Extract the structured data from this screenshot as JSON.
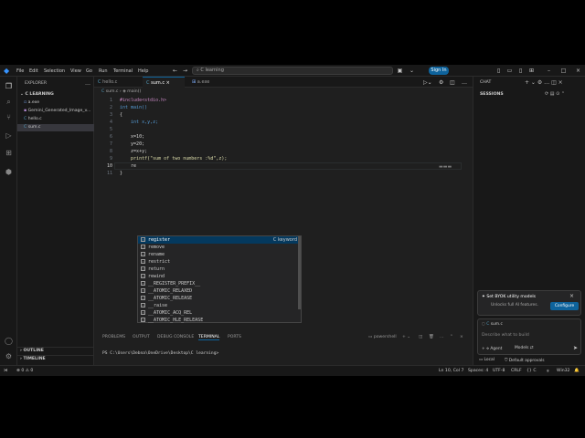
{
  "menu": [
    "File",
    "Edit",
    "Selection",
    "View",
    "Go",
    "Run",
    "Terminal",
    "Help"
  ],
  "search": {
    "text": "C learning"
  },
  "signin": "Sign In",
  "explorer": {
    "title": "EXPLORER",
    "folder": "C LEARNING",
    "files": [
      {
        "icon": "▫",
        "name": "a.exe"
      },
      {
        "icon": "▪",
        "name": "Gemini_Generated_Image_v..."
      },
      {
        "icon": "C",
        "name": "hello.c"
      },
      {
        "icon": "C",
        "name": "sum.c"
      }
    ],
    "outline": "OUTLINE",
    "timeline": "TIMELINE"
  },
  "tabs": [
    {
      "icon": "C",
      "name": "hello.c"
    },
    {
      "icon": "C",
      "name": "sum.c"
    },
    {
      "icon": "⊞",
      "name": "a.exe"
    }
  ],
  "breadcrumb": {
    "file": "sum.c",
    "sym": "main()"
  },
  "code": {
    "line_numbers": [
      "1",
      "2",
      "3",
      "4",
      "5",
      "6",
      "7",
      "8",
      "9",
      "10",
      "11"
    ],
    "lines": [
      "#include<stdio.h>",
      "int main()",
      "{",
      "    int x,y,z;",
      "",
      "    x=10;",
      "    y=20;",
      "    z=x+y;",
      "    printf(\"sum of two numbers :%d\",z);",
      "    re",
      "}"
    ]
  },
  "suggestions": {
    "detail": "C keyword",
    "items": [
      {
        "icon": "▭",
        "label": "register"
      },
      {
        "icon": "▭",
        "label": "remove"
      },
      {
        "icon": "▭",
        "label": "rename"
      },
      {
        "icon": "▭",
        "label": "restrict"
      },
      {
        "icon": "▭",
        "label": "return"
      },
      {
        "icon": "▭",
        "label": "rewind"
      },
      {
        "icon": "▭",
        "label": "__REGISTER_PREFIX__"
      },
      {
        "icon": "▭",
        "label": "__ATOMIC_RELAXED"
      },
      {
        "icon": "▭",
        "label": "__ATOMIC_RELEASE"
      },
      {
        "icon": "▭",
        "label": "__raise"
      },
      {
        "icon": "▭",
        "label": "__ATOMIC_ACQ_REL"
      },
      {
        "icon": "▭",
        "label": "__ATOMIC_HLE_RELEASE"
      }
    ]
  },
  "panel": {
    "tabs": [
      "PROBLEMS",
      "OUTPUT",
      "DEBUG CONSOLE",
      "TERMINAL",
      "PORTS"
    ],
    "shell": "powershell",
    "terminal_line": "PS C:\\Users\\Debna\\OneDrive\\Desktop\\C learning>"
  },
  "chat": {
    "title": "CHAT",
    "sessions": "SESSIONS",
    "promo_title": "Set BYOK utility models",
    "promo_sub": "Unlocks full AI features.",
    "configure": "Configure",
    "context": "sum.c",
    "placeholder": "Describe what to build",
    "agent": "Agent",
    "models": "Models",
    "local": "Local",
    "approvals": "Default approvals"
  },
  "status": {
    "errors": "0",
    "warnings": "0",
    "position": "Ln 10, Col 7",
    "spaces": "Spaces: 4",
    "encoding": "UTF-8",
    "eol": "CRLF",
    "lang": "C",
    "platform": "Win32"
  },
  "colors": {
    "accent": "#0e639c",
    "bg": "#1f1f1f"
  }
}
